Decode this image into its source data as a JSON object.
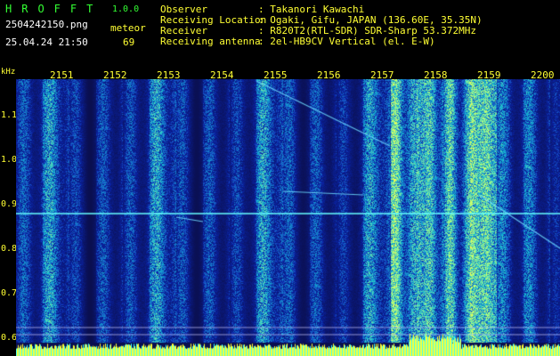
{
  "app": {
    "name": "HROFFT",
    "version": "1.0.0",
    "filename": "2504242150.png",
    "datetime": "25.04.24 21:50",
    "detection_label": "meteor",
    "detection_count": "69"
  },
  "info": [
    {
      "key": "Observer",
      "value": ": Takanori Kawachi"
    },
    {
      "key": "Receiving Location",
      "value": ": Ogaki, Gifu, JAPAN (136.60E, 35.35N)"
    },
    {
      "key": "Receiver",
      "value": ": R820T2(RTL-SDR) SDR-Sharp 53.372MHz"
    },
    {
      "key": "Receiving antenna",
      "value": ": 2el-HB9CV Vertical (el. E-W)"
    }
  ],
  "axis": {
    "y_unit": "kHz",
    "y_ticks": [
      "1.1",
      "1.0",
      "0.9",
      "0.8",
      "0.7",
      "0.6"
    ],
    "x_ticks": [
      "2151",
      "2152",
      "2153",
      "2154",
      "2155",
      "2156",
      "2157",
      "2158",
      "2159",
      "2200"
    ]
  },
  "colors": {
    "background": "#000000",
    "spectrum_base": "#1a2a9a",
    "signal": "#66ffff",
    "label_yellow": "#ffff33",
    "label_green": "#33ff33"
  }
}
